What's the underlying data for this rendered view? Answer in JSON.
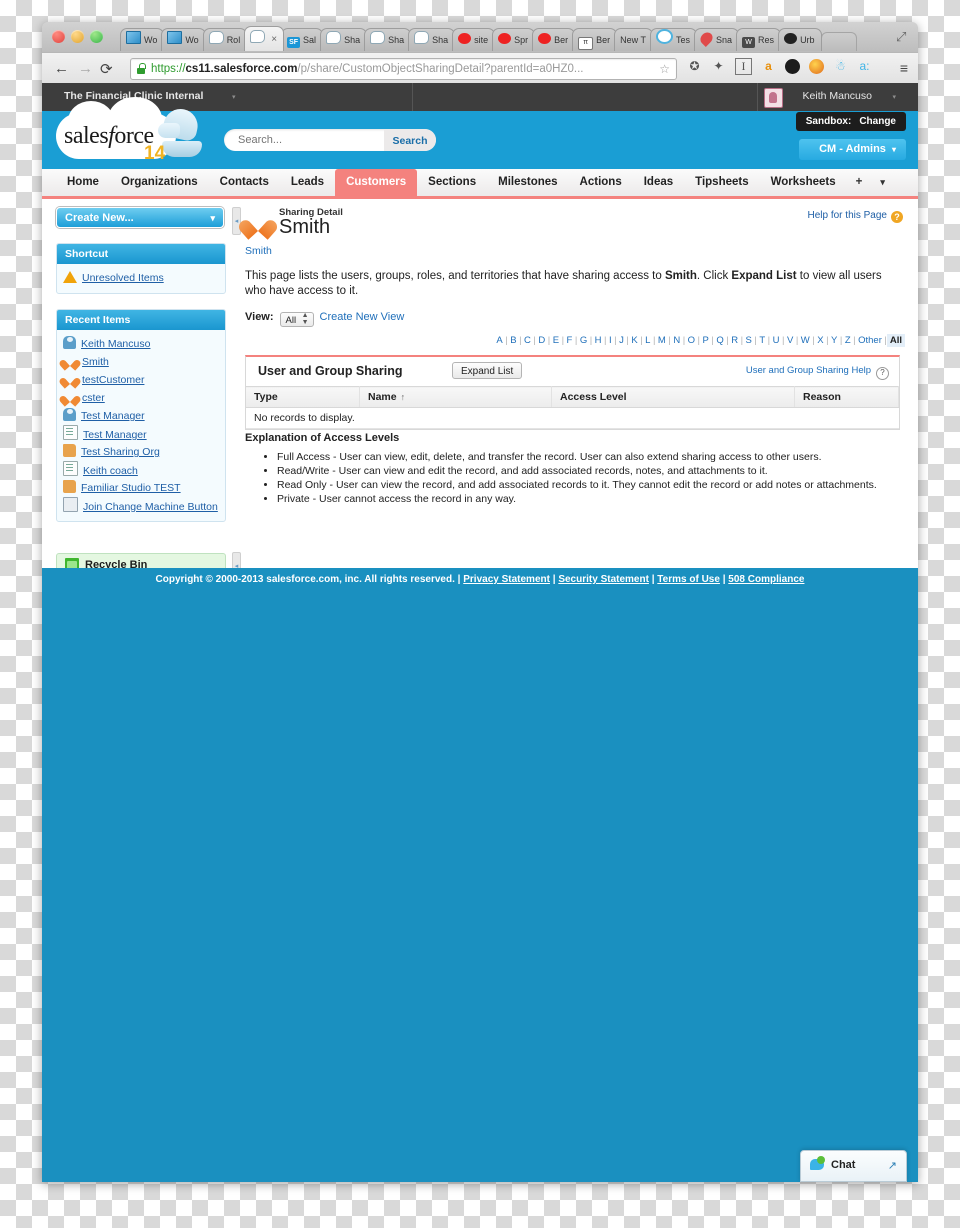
{
  "browser": {
    "tabs": [
      {
        "label": "Wo",
        "icon": "cube-icon"
      },
      {
        "label": "Wo",
        "icon": "cube-icon"
      },
      {
        "label": "Rol",
        "icon": "chat-bubble-icon"
      },
      {
        "label": "",
        "icon": "chat-bubble-icon",
        "active": true,
        "close": "×"
      },
      {
        "label": "Sal",
        "icon": "salesforce-icon"
      },
      {
        "label": "Sha",
        "icon": "chat-bubble-icon"
      },
      {
        "label": "Sha",
        "icon": "chat-bubble-icon"
      },
      {
        "label": "Sha",
        "icon": "chat-bubble-icon"
      },
      {
        "label": "site",
        "icon": "red-circle-icon"
      },
      {
        "label": "Spr",
        "icon": "red-circle-icon"
      },
      {
        "label": "Ber",
        "icon": "red-circle-icon"
      },
      {
        "label": "Ber",
        "icon": "pi-icon"
      },
      {
        "label": "New T",
        "icon": "none-icon"
      },
      {
        "label": "Tes",
        "icon": "ring-icon"
      },
      {
        "label": "Sna",
        "icon": "pin-icon"
      },
      {
        "label": "Res",
        "icon": "w-icon"
      },
      {
        "label": "Urb",
        "icon": "urban-icon"
      }
    ],
    "nav": {
      "back": "←",
      "forward": "→",
      "reload": "⟳"
    },
    "url": {
      "scheme": "https://",
      "host": "cs11.salesforce.com",
      "path": "/p/share/CustomObjectSharingDetail?parentId=a0HZ0...",
      "star": "☆"
    },
    "extensions": [
      "wrench-icon",
      "star-black-icon",
      "serif-I-icon",
      "amazon-icon",
      "black-oval-icon",
      "chrome-orb-icon",
      "blue-hand-icon",
      "a-colon-icon"
    ],
    "menu": "≡",
    "window_expand": "⤢"
  },
  "sf_header": {
    "org_name": "The Financial Clinic Internal",
    "org_caret": "▾",
    "user_name": "Keith Mancuso",
    "user_caret": "▾",
    "logo_text": "sales",
    "logo_text_italic": "f",
    "logo_text_rest": "orce",
    "logo_release": "14",
    "search_placeholder": "Search...",
    "search_value": "",
    "search_button": "Search",
    "sandbox_label": "Sandbox:",
    "sandbox_action": "Change",
    "app_menu": "CM - Admins",
    "app_menu_caret": "▾"
  },
  "nav_tabs": {
    "items": [
      {
        "label": "Home",
        "selected": false
      },
      {
        "label": "Organizations",
        "selected": false
      },
      {
        "label": "Contacts",
        "selected": false
      },
      {
        "label": "Leads",
        "selected": false
      },
      {
        "label": "Customers",
        "selected": true
      },
      {
        "label": "Sections",
        "selected": false
      },
      {
        "label": "Milestones",
        "selected": false
      },
      {
        "label": "Actions",
        "selected": false
      },
      {
        "label": "Ideas",
        "selected": false
      },
      {
        "label": "Tipsheets",
        "selected": false
      },
      {
        "label": "Worksheets",
        "selected": false
      }
    ],
    "plus": "+",
    "caret": "▾"
  },
  "sidebar": {
    "create_new": "Create New...",
    "create_new_caret": "▾",
    "shortcut_header": "Shortcut",
    "shortcut_items": [
      {
        "label": "Unresolved Items",
        "icon": "warning-icon"
      }
    ],
    "recent_header": "Recent Items",
    "recent_items": [
      {
        "label": "Keith Mancuso",
        "icon": "user-icon"
      },
      {
        "label": "Smith",
        "icon": "heart-icon"
      },
      {
        "label": "testCustomer",
        "icon": "heart-icon"
      },
      {
        "label": "cster",
        "icon": "heart-icon"
      },
      {
        "label": "Test Manager",
        "icon": "user-icon"
      },
      {
        "label": "Test Manager",
        "icon": "document-icon"
      },
      {
        "label": "Test Sharing Org",
        "icon": "folder-icon"
      },
      {
        "label": "Keith coach",
        "icon": "document-icon"
      },
      {
        "label": "Familiar Studio TEST",
        "icon": "folder-icon"
      },
      {
        "label": "Join Change Machine Button",
        "icon": "note-icon"
      }
    ],
    "recycle_bin": "Recycle Bin",
    "collapse_arrow": "◂"
  },
  "main": {
    "kicker": "Sharing Detail",
    "title": "Smith",
    "parent_link": "Smith",
    "help_for_page": "Help for this Page",
    "help_qmark": "?",
    "intro_1": "This page lists the users, groups, roles, and territories that have sharing access to ",
    "intro_bold_1": "Smith",
    "intro_2": ". Click ",
    "intro_bold_2": "Expand List",
    "intro_3": " to view all users who have access to it.",
    "view_label": "View:",
    "view_value": "All",
    "create_new_view": "Create New View",
    "alphabet": [
      "A",
      "B",
      "C",
      "D",
      "E",
      "F",
      "G",
      "H",
      "I",
      "J",
      "K",
      "L",
      "M",
      "N",
      "O",
      "P",
      "Q",
      "R",
      "S",
      "T",
      "U",
      "V",
      "W",
      "X",
      "Y",
      "Z"
    ],
    "alpha_other": "Other",
    "alpha_all": "All",
    "panel": {
      "title": "User and Group Sharing",
      "expand_list": "Expand List",
      "help_link": "User and Group Sharing Help",
      "help_qmark": "?",
      "columns": [
        "Type",
        "Name",
        "Access Level",
        "Reason"
      ],
      "sort_indicator": "↑",
      "rows": [],
      "empty_message": "No records to display."
    },
    "explanation": {
      "heading": "Explanation of Access Levels",
      "items": [
        "Full Access - User can view, edit, delete, and transfer the record. User can also extend sharing access to other users.",
        "Read/Write - User can view and edit the record, and add associated records, notes, and attachments to it.",
        "Read Only - User can view the record, and add associated records to it. They cannot edit the record or add notes or attachments.",
        "Private - User cannot access the record in any way."
      ]
    }
  },
  "footer": {
    "copyright": "Copyright © 2000-2013 salesforce.com, inc. All rights reserved. |",
    "links": [
      "Privacy Statement",
      "Security Statement",
      "Terms of Use",
      "508 Compliance"
    ],
    "separator": "|"
  },
  "chat": {
    "label": "Chat",
    "expand_arrow": "↗"
  },
  "colors": {
    "brand_blue": "#1a9ed4",
    "page_blue": "#1a90c0",
    "tab_selected": "#f4827e",
    "link_blue": "#1f6fba",
    "topbar_dark": "#3d3d3d"
  }
}
